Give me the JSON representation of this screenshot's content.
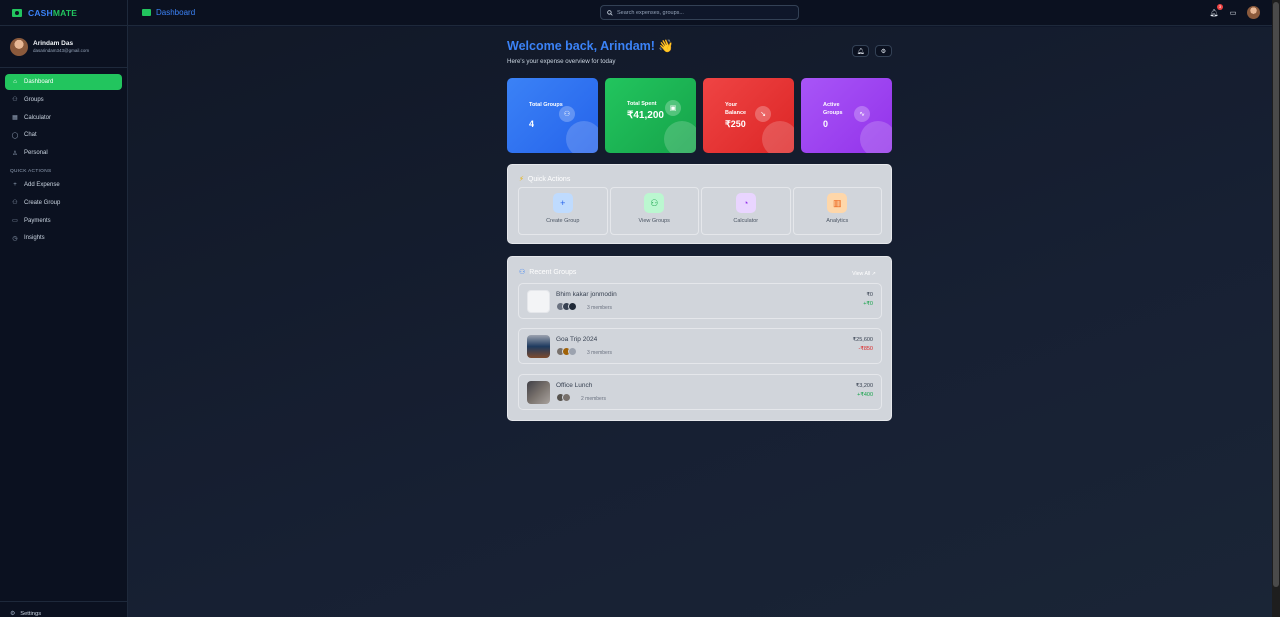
{
  "brand": {
    "part1": "CASH",
    "part2": "MATE"
  },
  "user": {
    "name": "Arindam Das",
    "email": "dasarindam343@gmail.com"
  },
  "nav": [
    {
      "label": "Dashboard",
      "icon": "home-icon",
      "glyph": "⌂"
    },
    {
      "label": "Groups",
      "icon": "users-icon",
      "glyph": "⚇"
    },
    {
      "label": "Calculator",
      "icon": "calculator-icon",
      "glyph": "▦"
    },
    {
      "label": "Chat",
      "icon": "chat-icon",
      "glyph": "◯"
    },
    {
      "label": "Personal",
      "icon": "user-icon",
      "glyph": "♙"
    }
  ],
  "quick_actions_heading": "QUICK ACTIONS",
  "sidebar_actions": [
    {
      "label": "Add Expense",
      "icon": "plus-icon",
      "glyph": "+"
    },
    {
      "label": "Create Group",
      "icon": "user-plus-icon",
      "glyph": "⚇"
    },
    {
      "label": "Payments",
      "icon": "card-icon",
      "glyph": "▭"
    },
    {
      "label": "Insights",
      "icon": "clock-icon",
      "glyph": "◷"
    }
  ],
  "settings_label": "Settings",
  "breadcrumb": "Dashboard",
  "search": {
    "placeholder": "Search expenses, groups..."
  },
  "notifications_count": "3",
  "welcome": {
    "title": "Welcome back, Arindam!",
    "emoji": "👋",
    "subtitle": "Here's your expense overview for today"
  },
  "stats": [
    {
      "label": "Total Groups",
      "value": "4",
      "icon": "users-icon",
      "glyph": "⚇"
    },
    {
      "label": "Total Spent",
      "value": "₹41,200",
      "icon": "wallet-icon",
      "glyph": "▣"
    },
    {
      "label": "Your Balance",
      "value": "₹250",
      "icon": "trend-down-icon",
      "glyph": "↘"
    },
    {
      "label": "Active Groups",
      "value": "0",
      "icon": "activity-icon",
      "glyph": "∿"
    }
  ],
  "quick_actions": {
    "title": "Quick Actions",
    "items": [
      {
        "label": "Create Group",
        "icon": "plus-icon",
        "glyph": "+",
        "bg": "#bfdbfe",
        "fg": "#2563eb"
      },
      {
        "label": "View Groups",
        "icon": "users-icon",
        "glyph": "⚇",
        "bg": "#bbf7d0",
        "fg": "#16a34a"
      },
      {
        "label": "Calculator",
        "icon": "pie-chart-icon",
        "glyph": "◔",
        "bg": "#e9d5ff",
        "fg": "#9333ea"
      },
      {
        "label": "Analytics",
        "icon": "bar-chart-icon",
        "glyph": "▥",
        "bg": "#fed7aa",
        "fg": "#ea580c"
      }
    ]
  },
  "recent_groups": {
    "title": "Recent Groups",
    "view_all": "View All ↗",
    "groups": [
      {
        "name": "Bhim kakar jonmodin",
        "members": "3 members",
        "amount": "₹0",
        "balance": "+₹0",
        "balance_color": "#16a34a",
        "thumb": "#f3f4f6"
      },
      {
        "name": "Goa Trip 2024",
        "members": "3 members",
        "amount": "₹25,600",
        "balance": "-₹850",
        "balance_color": "#dc2626",
        "thumb": "#1e3a5f"
      },
      {
        "name": "Office Lunch",
        "members": "2 members",
        "amount": "₹3,200",
        "balance": "+₹400",
        "balance_color": "#16a34a",
        "thumb": "#5b4636"
      }
    ]
  }
}
